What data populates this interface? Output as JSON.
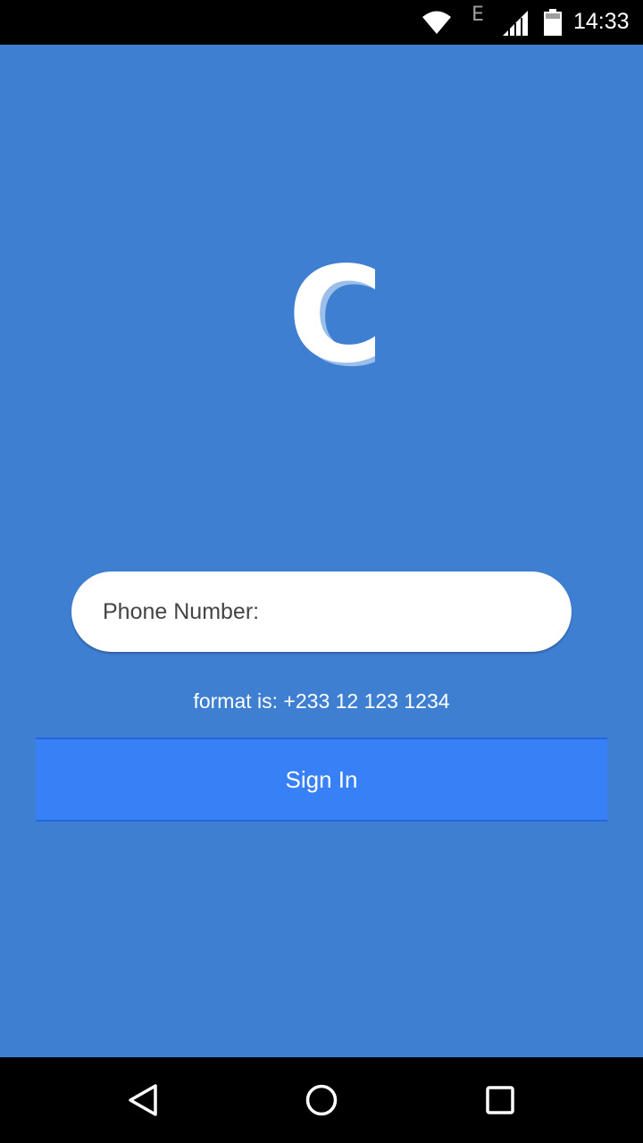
{
  "status_bar": {
    "time": "14:33",
    "network_type": "E",
    "icons": [
      "wifi-icon",
      "signal-icon",
      "battery-icon"
    ]
  },
  "logo": {
    "letter": "C",
    "color": "#ffffff",
    "shadow_color": "#9cbfea"
  },
  "login": {
    "phone_placeholder": "Phone Number:",
    "phone_value": "",
    "format_hint": "format is: +233 12 123 1234",
    "sign_in_label": "Sign In"
  },
  "nav_bar": {
    "icons": [
      "back-icon",
      "home-icon",
      "recent-apps-icon"
    ]
  },
  "colors": {
    "background": "#3e7fd2",
    "button": "#3880f5",
    "input_bg": "#ffffff"
  }
}
